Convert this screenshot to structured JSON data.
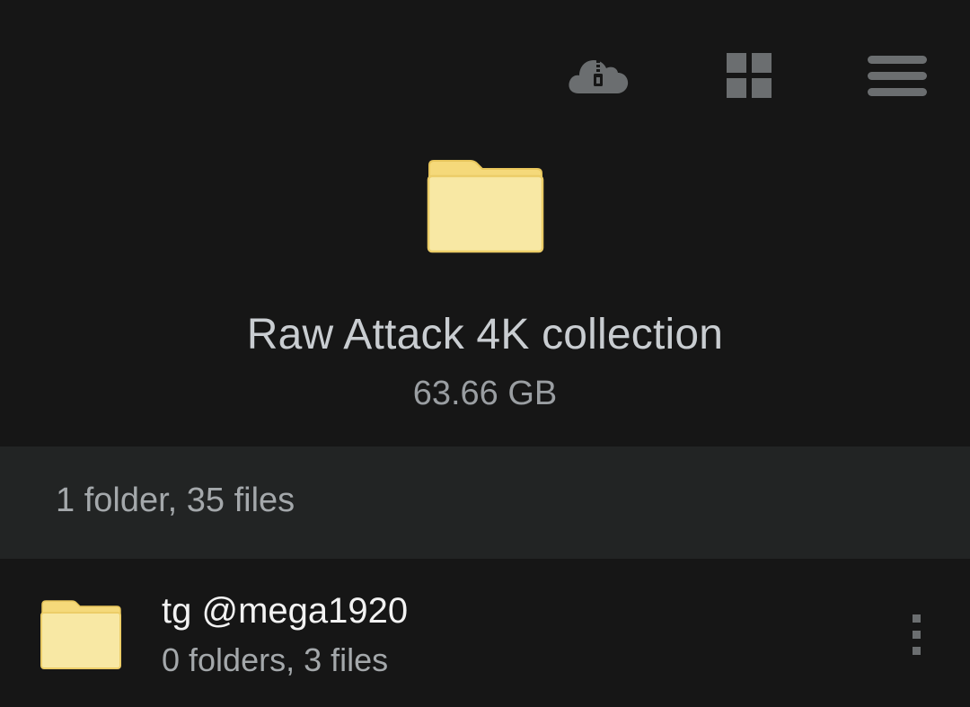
{
  "toolbar": {
    "icons": [
      "cloud-zip-icon",
      "grid-view-icon",
      "menu-icon"
    ]
  },
  "folder": {
    "title": "Raw Attack 4K collection",
    "size": "63.66 GB",
    "summary": "1 folder, 35 files"
  },
  "items": [
    {
      "name": "tg @mega1920",
      "meta": "0 folders, 3 files",
      "icon": "folder-icon"
    }
  ],
  "colors": {
    "background": "#161616",
    "summary_bar": "#222424",
    "folder_fill": "#f8e8a4",
    "folder_tab": "#f5d97a",
    "folder_border": "#e8c65c",
    "icon_gray": "#6b6e70"
  }
}
